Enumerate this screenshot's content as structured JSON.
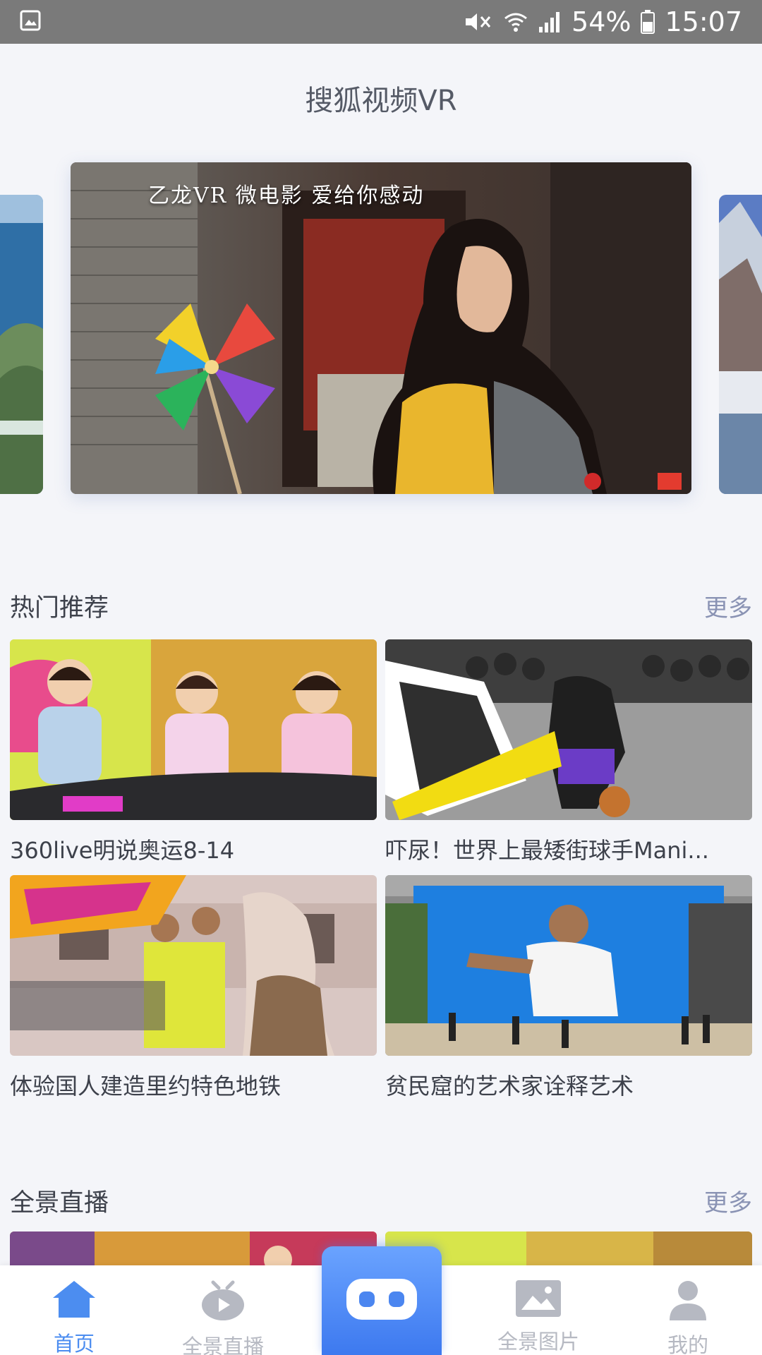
{
  "status_bar": {
    "battery": "54%",
    "time": "15:07"
  },
  "app": {
    "title": "搜狐视频VR"
  },
  "banner": {
    "caption": "乙龙VR 微电影 爱给你感动"
  },
  "sections": [
    {
      "title": "热门推荐",
      "more": "更多"
    },
    {
      "title": "全景直播",
      "more": "更多"
    }
  ],
  "hot": [
    {
      "title": "360live明说奥运8-14"
    },
    {
      "title": "吓尿！世界上最矮街球手Mani..."
    },
    {
      "title": "体验国人建造里约特色地铁"
    },
    {
      "title": "贫民窟的艺术家诠释艺术"
    }
  ],
  "nav": {
    "home": "首页",
    "live": "全景直播",
    "photos": "全景图片",
    "mine": "我的"
  },
  "colors": {
    "accent": "#4c8df0",
    "inactive": "#b6b9c2"
  }
}
